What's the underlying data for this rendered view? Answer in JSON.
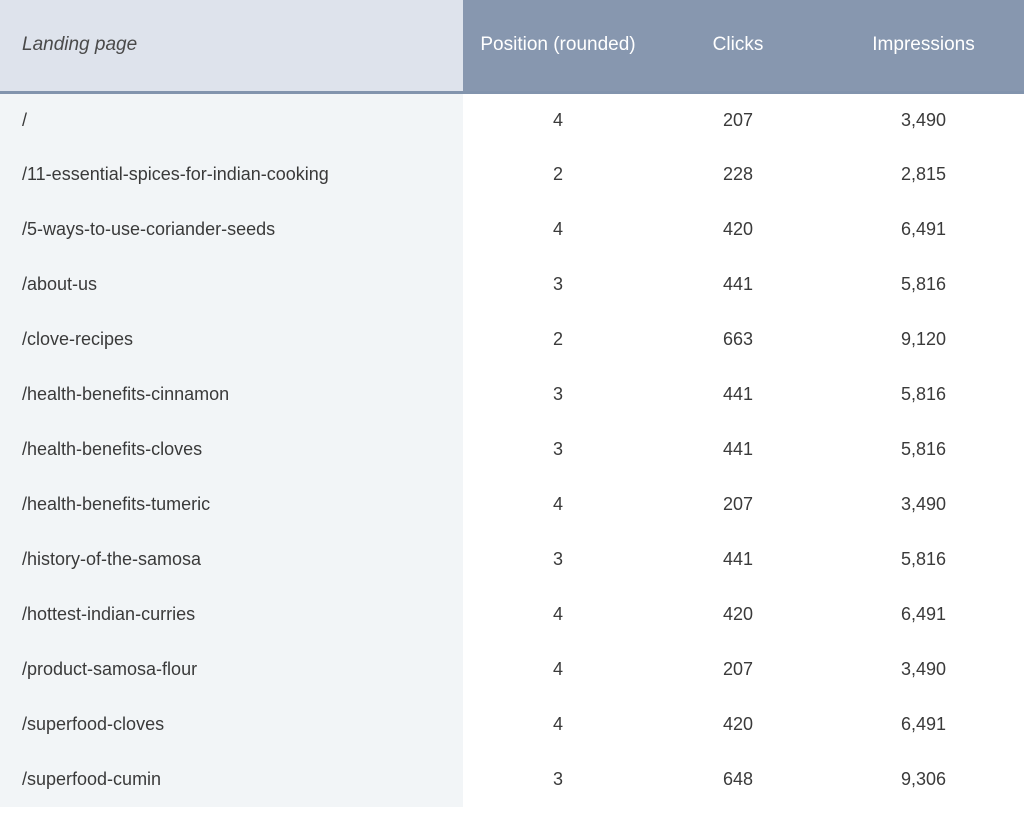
{
  "headers": {
    "landing": "Landing page",
    "position": "Position (rounded)",
    "clicks": "Clicks",
    "impressions": "Impressions"
  },
  "rows": [
    {
      "landing": "/",
      "position": "4",
      "clicks": "207",
      "impressions": "3,490"
    },
    {
      "landing": "/11-essential-spices-for-indian-cooking",
      "position": "2",
      "clicks": "228",
      "impressions": "2,815"
    },
    {
      "landing": "/5-ways-to-use-coriander-seeds",
      "position": "4",
      "clicks": "420",
      "impressions": "6,491"
    },
    {
      "landing": "/about-us",
      "position": "3",
      "clicks": "441",
      "impressions": "5,816"
    },
    {
      "landing": "/clove-recipes",
      "position": "2",
      "clicks": "663",
      "impressions": "9,120"
    },
    {
      "landing": "/health-benefits-cinnamon",
      "position": "3",
      "clicks": "441",
      "impressions": "5,816"
    },
    {
      "landing": "/health-benefits-cloves",
      "position": "3",
      "clicks": "441",
      "impressions": "5,816"
    },
    {
      "landing": "/health-benefits-tumeric",
      "position": "4",
      "clicks": "207",
      "impressions": "3,490"
    },
    {
      "landing": "/history-of-the-samosa",
      "position": "3",
      "clicks": "441",
      "impressions": "5,816"
    },
    {
      "landing": "/hottest-indian-curries",
      "position": "4",
      "clicks": "420",
      "impressions": "6,491"
    },
    {
      "landing": "/product-samosa-flour",
      "position": "4",
      "clicks": "207",
      "impressions": "3,490"
    },
    {
      "landing": "/superfood-cloves",
      "position": "4",
      "clicks": "420",
      "impressions": "6,491"
    },
    {
      "landing": "/superfood-cumin",
      "position": "3",
      "clicks": "648",
      "impressions": "9,306"
    }
  ]
}
